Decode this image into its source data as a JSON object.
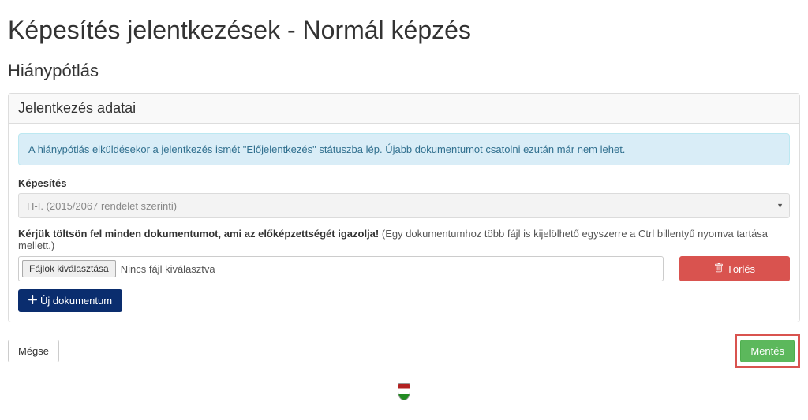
{
  "page": {
    "title": "Képesítés jelentkezések - Normál képzés",
    "subtitle": "Hiánypótlás"
  },
  "panel": {
    "heading": "Jelentkezés adatai",
    "info_message": "A hiánypótlás elküldésekor a jelentkezés ismét \"Előjelentkezés\" státuszba lép. Újabb dokumentumot csatolni ezután már nem lehet."
  },
  "form": {
    "qualification_label": "Képesítés",
    "qualification_value": "H-I. (2015/2067 rendelet szerinti)",
    "upload_label_bold": "Kérjük töltsön fel minden dokumentumot, ami az előképzettségét igazolja!",
    "upload_label_note": "(Egy dokumentumhoz több fájl is kijelölhető egyszerre a Ctrl billentyű nyomva tartása mellett.)",
    "file_choose_button": "Fájlok kiválasztása",
    "file_status": "Nincs fájl kiválasztva",
    "delete_button": "Törlés",
    "new_doc_button": "Új dokumentum"
  },
  "actions": {
    "cancel": "Mégse",
    "save": "Mentés"
  }
}
